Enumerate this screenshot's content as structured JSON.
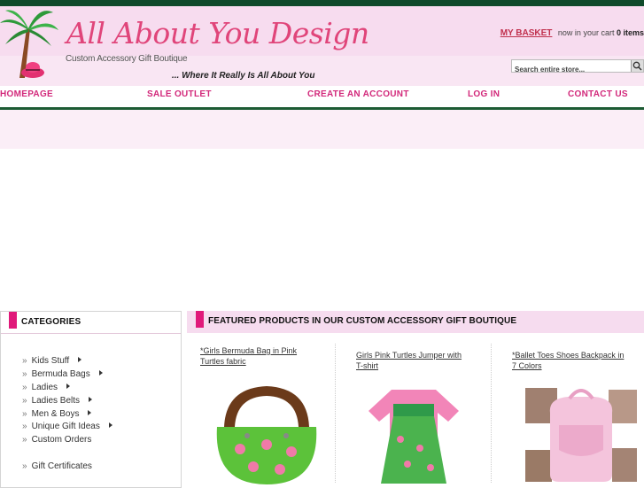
{
  "header": {
    "site_name": "All About You Design",
    "subtitle": "Custom Accessory Gift Boutique",
    "tagline": "... Where It Really Is All About You",
    "logo_icon": "palm-tree-hat-icon"
  },
  "basket": {
    "label": "MY BASKET",
    "text": "now in your cart",
    "count": "0 items"
  },
  "search": {
    "placeholder": "Search entire store...",
    "icon": "magnifier-icon"
  },
  "nav": {
    "items": [
      "HOMEPAGE",
      "SALE OUTLET",
      "CREATE AN ACCOUNT",
      "LOG IN",
      "CONTACT US"
    ]
  },
  "sidebar": {
    "title": "CATEGORIES",
    "items": [
      {
        "label": "Kids Stuff",
        "has_sub": true
      },
      {
        "label": "Bermuda Bags",
        "has_sub": true
      },
      {
        "label": "Ladies",
        "has_sub": true
      },
      {
        "label": "Ladies Belts",
        "has_sub": true
      },
      {
        "label": "Men & Boys",
        "has_sub": true
      },
      {
        "label": "Unique Gift Ideas",
        "has_sub": true
      },
      {
        "label": "Custom Orders",
        "has_sub": false
      },
      {
        "label": "Gift Certificates",
        "has_sub": false
      }
    ]
  },
  "featured": {
    "title": "FEATURED PRODUCTS IN OUR CUSTOM ACCESSORY GIFT BOUTIQUE",
    "products": [
      {
        "line1": "*Girls Bermuda Bag in Pink",
        "line2": "Turtles fabric"
      },
      {
        "line1": "Girls Pink Turtles Jumper with",
        "line2": "T-shirt"
      },
      {
        "line1": "*Ballet Toes Shoes Backpack in",
        "line2": "7 Colors"
      }
    ]
  },
  "colors": {
    "brand_pink": "#e0457a",
    "nav_pink": "#d2287a",
    "dark_green": "#0f4a2a"
  }
}
